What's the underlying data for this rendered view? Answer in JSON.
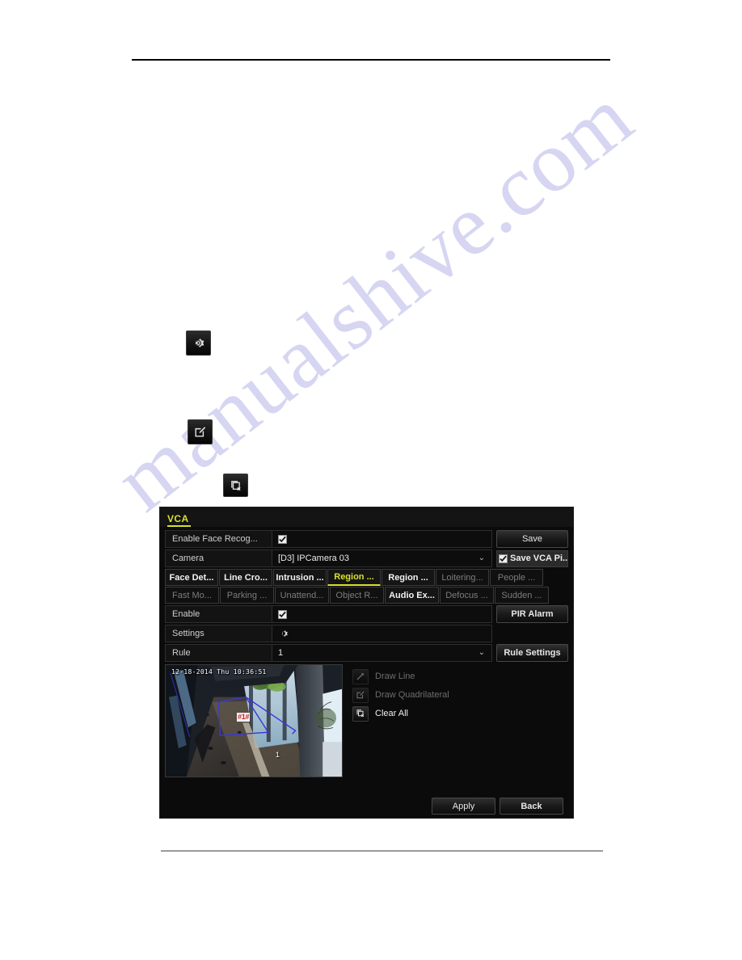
{
  "watermark": {
    "text": "manualshive.com"
  },
  "doc_icons": [
    {
      "name": "gear-icon",
      "glyph": "settings-gear"
    },
    {
      "name": "edit-icon",
      "glyph": "pencil-square"
    },
    {
      "name": "clear-all-icon",
      "glyph": "clear-region"
    }
  ],
  "dialog": {
    "title": "VCA",
    "rows": {
      "enable_face_recog_label": "Enable Face Recog...",
      "enable_face_recog_checked": true,
      "camera_label": "Camera",
      "camera_value": "[D3] IPCamera 03",
      "enable_label": "Enable",
      "enable_checked": true,
      "settings_label": "Settings",
      "rule_label": "Rule",
      "rule_value": "1"
    },
    "side_buttons": {
      "save_label": "Save",
      "save_vca_picture_label": "Save VCA Pi...",
      "save_vca_picture_checked": true,
      "pir_alarm_label": "PIR Alarm",
      "rule_settings_label": "Rule Settings"
    },
    "tabs_row1": [
      {
        "label": "Face Det...",
        "state": "normal"
      },
      {
        "label": "Line Cro...",
        "state": "normal"
      },
      {
        "label": "Intrusion ...",
        "state": "normal"
      },
      {
        "label": "Region ...",
        "state": "active"
      },
      {
        "label": "Region ...",
        "state": "normal"
      },
      {
        "label": "Loitering...",
        "state": "dim"
      },
      {
        "label": "People ...",
        "state": "dim"
      }
    ],
    "tabs_row2": [
      {
        "label": "Fast Mo...",
        "state": "dim"
      },
      {
        "label": "Parking ...",
        "state": "dim"
      },
      {
        "label": "Unattend...",
        "state": "dim"
      },
      {
        "label": "Object R...",
        "state": "dim"
      },
      {
        "label": "Audio Ex...",
        "state": "normal"
      },
      {
        "label": "Defocus ...",
        "state": "dim"
      },
      {
        "label": "Sudden ...",
        "state": "dim"
      }
    ],
    "preview": {
      "timestamp": "12-18-2014 Thu 10:36:51",
      "region_label": "#1#",
      "region_number": "1"
    },
    "tools": [
      {
        "label": "Draw Line",
        "icon": "draw-line-icon",
        "enabled": false
      },
      {
        "label": "Draw Quadrilateral",
        "icon": "draw-quadrilateral-icon",
        "enabled": false
      },
      {
        "label": "Clear All",
        "icon": "clear-all-icon",
        "enabled": true
      }
    ],
    "footer": {
      "apply_label": "Apply",
      "back_label": "Back"
    }
  },
  "colors": {
    "accent_yellow": "#d9e02a",
    "region_outline": "#3a36d8",
    "region_label_red": "#c8252a",
    "dialog_bg": "#0b0b0b"
  }
}
